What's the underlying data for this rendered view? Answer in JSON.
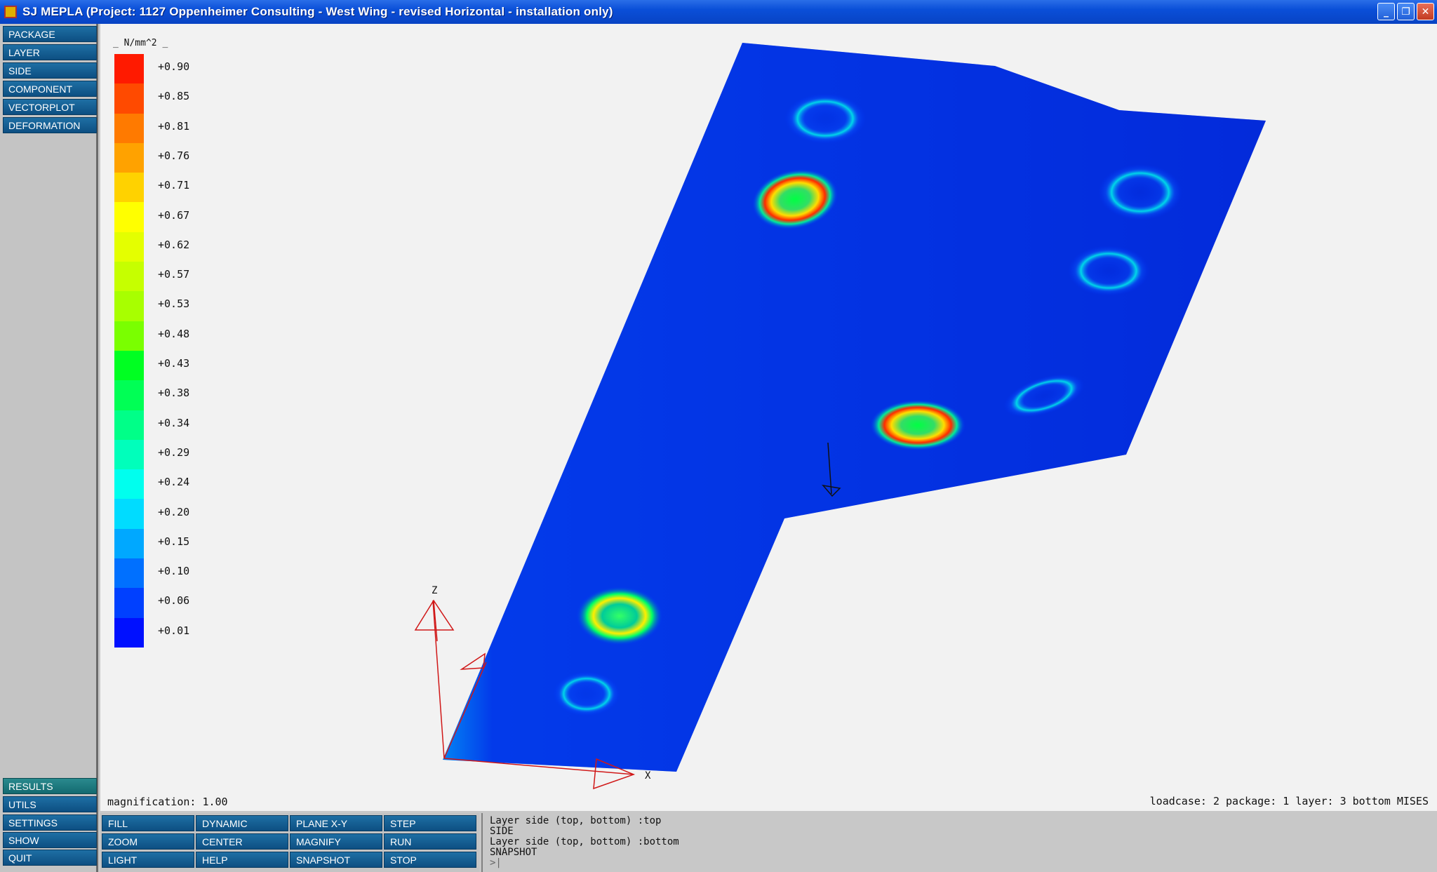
{
  "window": {
    "title": "SJ MEPLA (Project: 1127 Oppenheimer Consulting - West Wing - revised Horizontal - installation only)",
    "controls": {
      "minimize": "_",
      "maximize": "❐",
      "close": "✕"
    }
  },
  "left_menu": {
    "top": [
      "PACKAGE",
      "LAYER",
      "SIDE",
      "COMPONENT",
      "VECTORPLOT",
      "DEFORMATION"
    ],
    "bottom": [
      "RESULTS",
      "UTILS",
      "SETTINGS",
      "SHOW",
      "QUIT"
    ]
  },
  "legend": {
    "unit": "_  N/mm^2 _",
    "labels": [
      "+0.90",
      "+0.85",
      "+0.81",
      "+0.76",
      "+0.71",
      "+0.67",
      "+0.62",
      "+0.57",
      "+0.53",
      "+0.48",
      "+0.43",
      "+0.38",
      "+0.34",
      "+0.29",
      "+0.24",
      "+0.20",
      "+0.15",
      "+0.10",
      "+0.06",
      "+0.01"
    ],
    "colors": [
      "#ff1a00",
      "#ff4a00",
      "#ff7a00",
      "#ffa200",
      "#ffd200",
      "#ffff00",
      "#e4ff00",
      "#c6ff00",
      "#a8ff00",
      "#7aff00",
      "#00ff22",
      "#00ff55",
      "#00ff88",
      "#00ffbb",
      "#00ffee",
      "#00dcff",
      "#00a8ff",
      "#0070ff",
      "#0040ff",
      "#0010ff"
    ]
  },
  "axes": {
    "z_label": "Z",
    "x_label": "X"
  },
  "status": {
    "magnification": "magnification:  1.00",
    "loadcase": "loadcase:  2 package: 1 layer: 3 bottom MISES"
  },
  "bottom_buttons": [
    [
      "FILL",
      "DYNAMIC",
      "PLANE X-Y",
      "STEP"
    ],
    [
      "ZOOM",
      "CENTER",
      "MAGNIFY",
      "RUN"
    ],
    [
      "LIGHT",
      "HELP",
      "SNAPSHOT",
      "STOP"
    ]
  ],
  "console": {
    "lines": [
      "Layer side (top, bottom) :top",
      "SIDE",
      "Layer side (top, bottom) :bottom",
      "SNAPSHOT"
    ],
    "prompt": ">|"
  }
}
